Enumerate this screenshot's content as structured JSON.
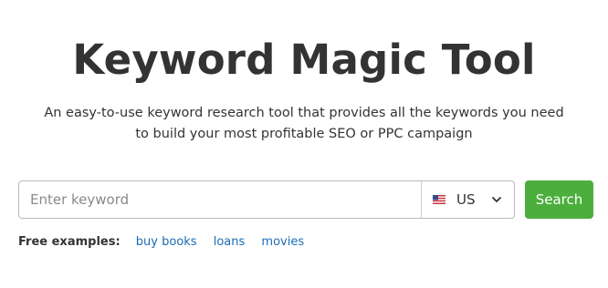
{
  "header": {
    "title": "Keyword Magic Tool",
    "subtitle": "An easy-to-use keyword research tool that provides all the keywords you need to build your most profitable SEO or PPC campaign"
  },
  "search": {
    "placeholder": "Enter keyword",
    "value": "",
    "country_code": "US",
    "country_flag_icon": "us-flag-icon",
    "dropdown_icon": "chevron-down-icon",
    "button_label": "Search"
  },
  "examples": {
    "label": "Free examples:",
    "items": [
      "buy books",
      "loans",
      "movies"
    ]
  },
  "colors": {
    "accent_green": "#4cae3d",
    "link_blue": "#1a6bb5",
    "text_dark": "#333333",
    "border_gray": "#b9b9b9"
  }
}
